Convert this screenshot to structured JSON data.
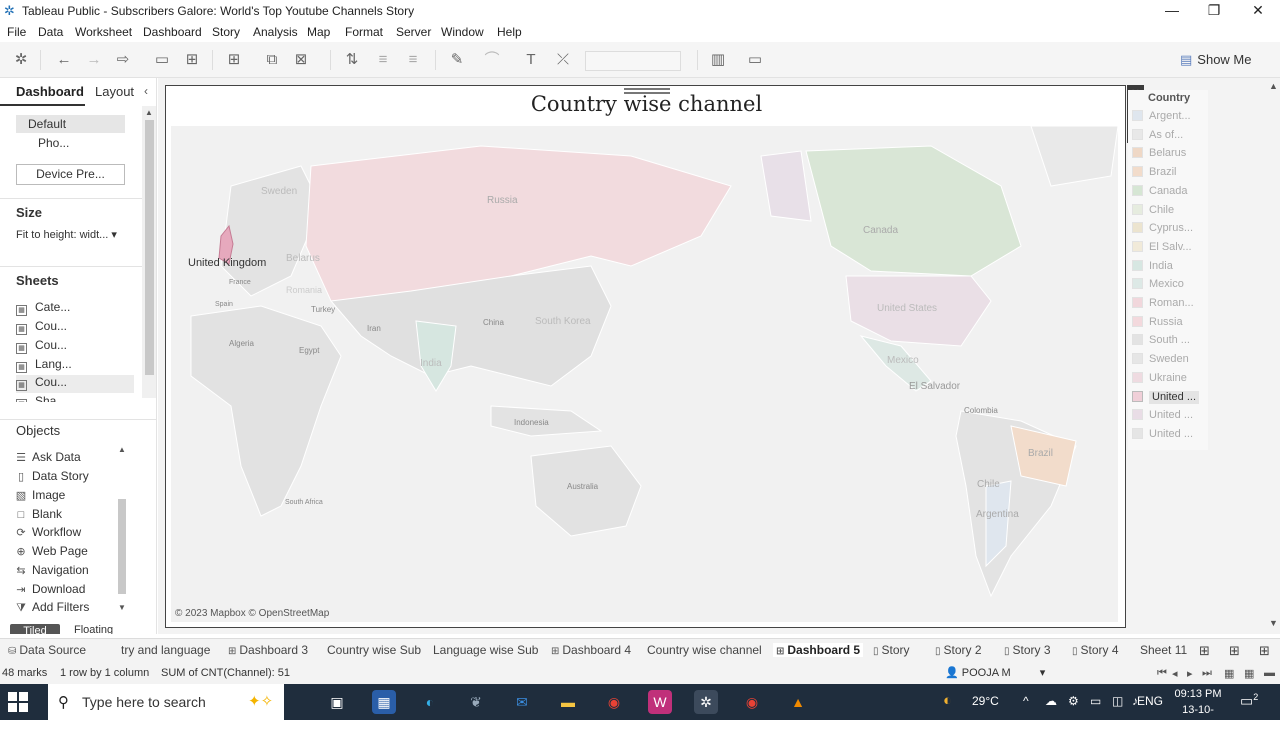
{
  "window": {
    "title": "Tableau Public - Subscribers Galore: World's Top Youtube Channels Story",
    "controls": {
      "minimize": "—",
      "restore": "❐",
      "close": "✕"
    }
  },
  "menu": [
    "File",
    "Data",
    "Worksheet",
    "Dashboard",
    "Story",
    "Analysis",
    "Map",
    "Format",
    "Server",
    "Window",
    "Help"
  ],
  "toolbar": {
    "show_me": "Show Me"
  },
  "left_panel": {
    "tab_dashboard": "Dashboard",
    "tab_layout": "Layout",
    "devices": [
      "Default",
      "Pho..."
    ],
    "device_preview": "Device Pre...",
    "size_title": "Size",
    "size_value": "Fit to height: widt...",
    "sheets_title": "Sheets",
    "sheets": [
      "Cate...",
      "Cou...",
      "Cou...",
      "Lang...",
      "Cou...",
      "Sha..."
    ],
    "objects_title": "Objects",
    "objects": [
      {
        "label": "Ask Data",
        "icon": "ask-data-icon"
      },
      {
        "label": "Data Story",
        "icon": "data-story-icon"
      },
      {
        "label": "Image",
        "icon": "image-icon"
      },
      {
        "label": "Blank",
        "icon": "blank-icon"
      },
      {
        "label": "Workflow",
        "icon": "workflow-icon"
      },
      {
        "label": "Web Page",
        "icon": "web-page-icon"
      },
      {
        "label": "Navigation",
        "icon": "navigation-icon"
      },
      {
        "label": "Download",
        "icon": "download-icon"
      },
      {
        "label": "Add Filters",
        "icon": "add-filters-icon"
      }
    ],
    "tiled": "Tiled",
    "floating": "Floating"
  },
  "dashboard": {
    "title": "Country wise channel",
    "map_attribution": "© 2023 Mapbox © OpenStreetMap",
    "map_labels": {
      "uk": "United Kingdom",
      "russia": "Russia",
      "canada": "Canada",
      "us": "United States",
      "mexico": "Mexico",
      "el_salvador": "El Salvador",
      "brazil": "Brazil",
      "chile": "Chile",
      "argentina": "Argentina",
      "colombia": "Colombia",
      "india": "India",
      "china": "China",
      "south_korea": "South Korea",
      "sweden": "Sweden",
      "belarus": "Belarus",
      "romania": "Romania",
      "turkey": "Turkey",
      "iran": "Iran",
      "algeria": "Algeria",
      "egypt": "Egypt",
      "indonesia": "Indonesia",
      "australia": "Australia",
      "south_africa": "South Africa",
      "spain": "Spain",
      "france": "France"
    }
  },
  "legend": {
    "title": "Country",
    "items": [
      {
        "label": "Argent...",
        "color": "#dfe6ee"
      },
      {
        "label": "As of...",
        "color": "#e8e8e8"
      },
      {
        "label": "Belarus",
        "color": "#efd8c6"
      },
      {
        "label": "Brazil",
        "color": "#f2dccb"
      },
      {
        "label": "Canada",
        "color": "#d6e6d4"
      },
      {
        "label": "Chile",
        "color": "#e6ecdf"
      },
      {
        "label": "Cyprus...",
        "color": "#ece4cf"
      },
      {
        "label": "El Salv...",
        "color": "#f1ead9"
      },
      {
        "label": "India",
        "color": "#d7e7e2"
      },
      {
        "label": "Mexico",
        "color": "#dde9e6"
      },
      {
        "label": "Roman...",
        "color": "#f1d7dc"
      },
      {
        "label": "Russia",
        "color": "#f3d9dd"
      },
      {
        "label": "South ...",
        "color": "#e3e3e3"
      },
      {
        "label": "Sweden",
        "color": "#e6e6e6"
      },
      {
        "label": "Ukraine",
        "color": "#efdbe1"
      },
      {
        "label": "United ...",
        "color": "#f0cfd8",
        "selected": true
      },
      {
        "label": "United ...",
        "color": "#e9dde6"
      },
      {
        "label": "United ...",
        "color": "#e5e5e5"
      }
    ]
  },
  "sheet_tabs": [
    {
      "label": "Data Source",
      "icon": "database-icon"
    },
    {
      "label": "try and language",
      "icon": ""
    },
    {
      "label": "Dashboard 3",
      "icon": "dashboard-icon"
    },
    {
      "label": "Country wise Sub",
      "icon": ""
    },
    {
      "label": "Language wise Sub",
      "icon": ""
    },
    {
      "label": "Dashboard 4",
      "icon": "dashboard-icon"
    },
    {
      "label": "Country wise channel",
      "icon": ""
    },
    {
      "label": "Dashboard 5",
      "icon": "dashboard-icon",
      "active": true
    },
    {
      "label": "Story",
      "icon": "story-icon"
    },
    {
      "label": "Story 2",
      "icon": "story-icon"
    },
    {
      "label": "Story 3",
      "icon": "story-icon"
    },
    {
      "label": "Story 4",
      "icon": "story-icon"
    },
    {
      "label": "Sheet 11",
      "icon": ""
    }
  ],
  "status": {
    "marks": "48 marks",
    "rows_cols": "1 row by 1 column",
    "sum": "SUM of CNT(Channel): 51",
    "user": "POOJA M"
  },
  "taskbar": {
    "search_placeholder": "Type here to search",
    "weather": "29°C",
    "lang": "ENG",
    "time": "09:13 PM",
    "date": "13-10-2023",
    "notif_count": "2"
  }
}
